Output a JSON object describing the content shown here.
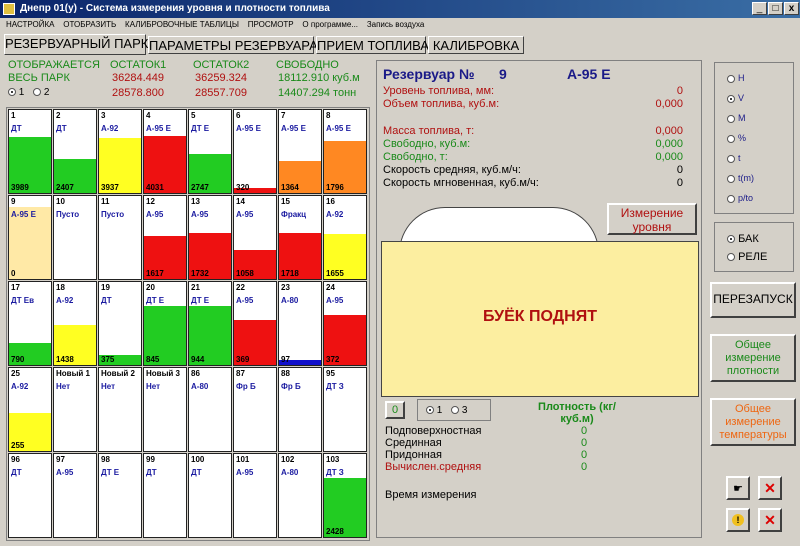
{
  "window": {
    "title": "Днепр 01(у) - Система измерения уровня и плотности топлива",
    "min": "_",
    "max": "□",
    "close": "x"
  },
  "menu": [
    "НАСТРОЙКА",
    "ОТОБРАЗИТЬ",
    "КАЛИБРОВОЧНЫЕ ТАБЛИЦЫ",
    "ПРОСМОТР",
    "О программе...",
    "Запись воздуха"
  ],
  "tabs": [
    "РЕЗЕРВУАРНЫЙ ПАРК",
    "ПАРАМЕТРЫ РЕЗЕРВУАРА",
    "ПРИЕМ ТОПЛИВА",
    "КАЛИБРОВКА"
  ],
  "summary": {
    "shows": "ОТОБРАЖАЕТСЯ",
    "whole_park": "ВЕСЬ ПАРК",
    "radio1": "1",
    "radio2": "2",
    "col1_header": "ОСТАТОК1",
    "col2_header": "ОСТАТОК2",
    "col3_header": "СВОБОДНО",
    "col1_row1": "36284.449",
    "col1_row2": "28578.800",
    "col2_row1": "36259.324",
    "col2_row2": "28557.709",
    "col3_row1": "18112.910 куб.м",
    "col3_row2": "14407.294 тонн"
  },
  "tanks": [
    {
      "num": "1",
      "fuel": "ДТ",
      "vol": "3989",
      "level": 0.78,
      "color": "#22cc22"
    },
    {
      "num": "2",
      "fuel": "ДТ",
      "vol": "2407",
      "level": 0.47,
      "color": "#22cc22"
    },
    {
      "num": "3",
      "fuel": "А-92",
      "vol": "3937",
      "level": 0.77,
      "color": "#ffff22"
    },
    {
      "num": "4",
      "fuel": "А-95 Е",
      "vol": "4031",
      "level": 0.79,
      "color": "#ee1111"
    },
    {
      "num": "5",
      "fuel": "ДТ Е",
      "vol": "2747",
      "level": 0.54,
      "color": "#22cc22"
    },
    {
      "num": "6",
      "fuel": "А-95 Е",
      "vol": "320",
      "level": 0.07,
      "color": "#ee1111"
    },
    {
      "num": "7",
      "fuel": "А-95 Е",
      "vol": "1364",
      "level": 0.45,
      "color": "#ff8822"
    },
    {
      "num": "8",
      "fuel": "А-95 Е",
      "vol": "1796",
      "level": 0.72,
      "color": "#ff8822"
    },
    {
      "num": "9",
      "fuel": "А-95 Е",
      "vol": "0",
      "level": 1.0,
      "color": "#ffe9a6"
    },
    {
      "num": "10",
      "fuel": "Пусто",
      "vol": "",
      "level": 0,
      "color": "#ffffff"
    },
    {
      "num": "11",
      "fuel": "Пусто",
      "vol": "",
      "level": 0,
      "color": "#ffffff"
    },
    {
      "num": "12",
      "fuel": "А-95",
      "vol": "1617",
      "level": 0.6,
      "color": "#ee1111"
    },
    {
      "num": "13",
      "fuel": "А-95",
      "vol": "1732",
      "level": 0.64,
      "color": "#ee1111"
    },
    {
      "num": "14",
      "fuel": "А-95",
      "vol": "1058",
      "level": 0.4,
      "color": "#ee1111"
    },
    {
      "num": "15",
      "fuel": "Фракц",
      "vol": "1718",
      "level": 0.64,
      "color": "#ee1111"
    },
    {
      "num": "16",
      "fuel": "А-92",
      "vol": "1655",
      "level": 0.62,
      "color": "#ffff22"
    },
    {
      "num": "17",
      "fuel": "ДТ Ев",
      "vol": "790",
      "level": 0.3,
      "color": "#22cc22"
    },
    {
      "num": "18",
      "fuel": "А-92",
      "vol": "1438",
      "level": 0.55,
      "color": "#ffff22"
    },
    {
      "num": "19",
      "fuel": "ДТ",
      "vol": "375",
      "level": 0.14,
      "color": "#22cc22"
    },
    {
      "num": "20",
      "fuel": "ДТ Е",
      "vol": "845",
      "level": 0.82,
      "color": "#22cc22"
    },
    {
      "num": "21",
      "fuel": "ДТ Е",
      "vol": "944",
      "level": 0.82,
      "color": "#22cc22"
    },
    {
      "num": "22",
      "fuel": "А-95",
      "vol": "369",
      "level": 0.62,
      "color": "#ee1111"
    },
    {
      "num": "23",
      "fuel": "А-80",
      "vol": "97",
      "level": 0.07,
      "color": "#1111cc"
    },
    {
      "num": "24",
      "fuel": "А-95",
      "vol": "372",
      "level": 0.7,
      "color": "#ee1111"
    },
    {
      "num": "25",
      "fuel": "А-92",
      "vol": "255",
      "level": 0.53,
      "color": "#ffff22"
    },
    {
      "num": "Новый 1",
      "fuel": "Нет",
      "vol": "",
      "level": 0,
      "color": "#ffffff"
    },
    {
      "num": "Новый 2",
      "fuel": "Нет",
      "vol": "",
      "level": 0,
      "color": "#ffffff"
    },
    {
      "num": "Новый 3",
      "fuel": "Нет",
      "vol": "",
      "level": 0,
      "color": "#ffffff"
    },
    {
      "num": "86",
      "fuel": "А-80",
      "vol": "",
      "level": 0,
      "color": "#ffffff"
    },
    {
      "num": "87",
      "fuel": "Фр Б",
      "vol": "",
      "level": 0,
      "color": "#ffffff"
    },
    {
      "num": "88",
      "fuel": "Фр Б",
      "vol": "",
      "level": 0,
      "color": "#ffffff"
    },
    {
      "num": "95",
      "fuel": "ДТ З",
      "vol": "",
      "level": 0,
      "color": "#ffffff"
    },
    {
      "num": "96",
      "fuel": "ДТ",
      "vol": "",
      "level": 0,
      "color": "#ffffff"
    },
    {
      "num": "97",
      "fuel": "А-95",
      "vol": "",
      "level": 0,
      "color": "#ffffff"
    },
    {
      "num": "98",
      "fuel": "ДТ Е",
      "vol": "",
      "level": 0,
      "color": "#ffffff"
    },
    {
      "num": "99",
      "fuel": "ДТ",
      "vol": "",
      "level": 0,
      "color": "#ffffff"
    },
    {
      "num": "100",
      "fuel": "ДТ",
      "vol": "",
      "level": 0,
      "color": "#ffffff"
    },
    {
      "num": "101",
      "fuel": "А-95",
      "vol": "",
      "level": 0,
      "color": "#ffffff"
    },
    {
      "num": "102",
      "fuel": "А-80",
      "vol": "",
      "level": 0,
      "color": "#ffffff"
    },
    {
      "num": "103",
      "fuel": "ДТ З",
      "vol": "2428",
      "level": 0.82,
      "color": "#22cc22"
    }
  ],
  "reservoir": {
    "label": "Резервуар №",
    "number": "9",
    "fuel": "А-95 Е",
    "params": [
      {
        "label": "Уровень топлива, мм:",
        "value": "0",
        "color": "#b01010"
      },
      {
        "label": "Объем топлива, куб.м:",
        "value": "0,000",
        "color": "#b01010"
      },
      {
        "label": "Масса топлива, т:",
        "value": "0,000",
        "color": "#b01010"
      },
      {
        "label": "Свободно, куб.м:",
        "value": "0,000",
        "color": "#1a8a1a"
      },
      {
        "label": "Свободно, т:",
        "value": "0,000",
        "color": "#1a8a1a"
      },
      {
        "label": "Скорость средняя, куб.м/ч:",
        "value": "0",
        "color": "#000000"
      },
      {
        "label": "Скорость мгновенная, куб.м/ч:",
        "value": "0",
        "color": "#000000"
      }
    ],
    "measure_btn": "Измерение уровня",
    "float_status": "БУЁК ПОДНЯТ",
    "counter": "0",
    "density_radio1": "1",
    "density_radio3": "3",
    "density_header": "Плотность (кг/куб.м)",
    "density_rows": [
      {
        "label": "Подповерхностная",
        "value": "0",
        "color": "#000000"
      },
      {
        "label": "Срединная",
        "value": "0",
        "color": "#000000"
      },
      {
        "label": "Придонная",
        "value": "0",
        "color": "#000000"
      },
      {
        "label": "Вычислен.средняя",
        "value": "0",
        "color": "#b01010"
      }
    ],
    "measure_time": "Время измерения"
  },
  "right_panel": {
    "units": [
      "H",
      "V",
      "M",
      "%",
      "t",
      "t(m)",
      "p/to"
    ],
    "units_selected": 1,
    "mode_bak": "БАК",
    "mode_rele": "РЕЛЕ",
    "restart_btn": "ПЕРЕЗАПУСК",
    "density_all_btn": "Общее измерение плотности",
    "temp_all_btn": "Общее измерение температуры"
  },
  "colors": {
    "green_text": "#1a8a1a",
    "red_text": "#b01010",
    "tank_panel_bg": "#fceea0",
    "selected_tank": "#ffe9a6"
  }
}
